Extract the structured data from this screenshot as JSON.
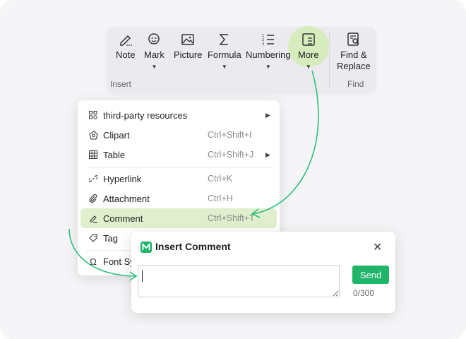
{
  "ribbon": {
    "tools": [
      {
        "label": "Note",
        "icon": "note-pen-icon",
        "caret": false
      },
      {
        "label": "Mark",
        "icon": "mark-face-icon",
        "caret": true
      },
      {
        "label": "Picture",
        "icon": "picture-icon",
        "caret": false
      },
      {
        "label": "Formula",
        "icon": "sigma-icon",
        "caret": true
      },
      {
        "label": "Numbering",
        "icon": "numbered-list-icon",
        "caret": true
      },
      {
        "label": "More",
        "icon": "more-panel-icon",
        "caret": true,
        "highlighted": true
      },
      {
        "label": "Find &",
        "label2": "Replace",
        "icon": "find-replace-icon",
        "caret": false
      }
    ],
    "groups": {
      "insert": "Insert",
      "find": "Find"
    },
    "highlight_color": "#d6ecbd"
  },
  "menu": {
    "items": [
      {
        "label": "third-party resources",
        "shortcut": "",
        "submenu": true,
        "icon": "grid-apps-icon"
      },
      {
        "label": "Clipart",
        "shortcut": "Ctrl+Shift+I",
        "submenu": false,
        "icon": "clipart-icon"
      },
      {
        "label": "Table",
        "shortcut": "Ctrl+Shift+J",
        "submenu": true,
        "icon": "table-icon"
      },
      {
        "label": "Hyperlink",
        "shortcut": "Ctrl+K",
        "submenu": false,
        "icon": "link-icon"
      },
      {
        "label": "Attachment",
        "shortcut": "Ctrl+H",
        "submenu": false,
        "icon": "paperclip-icon"
      },
      {
        "label": "Comment",
        "shortcut": "Ctrl+Shift+T",
        "submenu": false,
        "icon": "comment-pen-icon",
        "active": true
      },
      {
        "label": "Tag",
        "shortcut": "",
        "submenu": false,
        "icon": "tag-icon"
      },
      {
        "label": "Font Sy",
        "shortcut": "",
        "submenu": false,
        "icon": "omega-icon"
      }
    ],
    "active_color": "#e0efcd"
  },
  "dialog": {
    "title": "Insert Comment",
    "input_value": "",
    "send_label": "Send",
    "counter": "0/300",
    "accent": "#21b46b"
  },
  "arrows_color": "#2cc07e"
}
